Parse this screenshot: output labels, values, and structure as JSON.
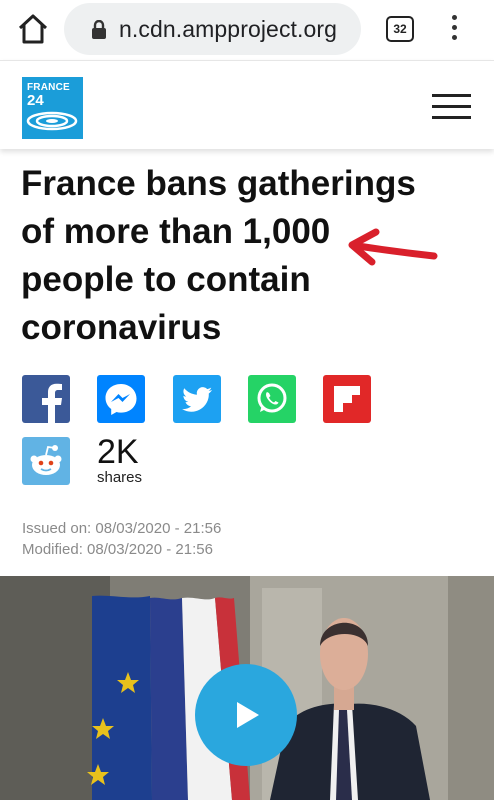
{
  "browser": {
    "url": "n.cdn.ampproject.org",
    "tab_count": "32",
    "icons": [
      "home-icon",
      "lock-icon",
      "kebab-menu-icon"
    ]
  },
  "site": {
    "logo_line1": "FRANCE",
    "logo_line2": "24",
    "colors": {
      "brand": "#1b9dd9"
    }
  },
  "article": {
    "headline": "France bans gatherings of more than 1,000 people to contain coronavirus",
    "issued": "Issued on: 08/03/2020 - 21:56",
    "modified": "Modified: 08/03/2020 - 21:56"
  },
  "share": {
    "networks": [
      "facebook",
      "messenger",
      "twitter",
      "whatsapp",
      "flipboard",
      "reddit"
    ],
    "count": "2K",
    "label": "shares",
    "colors": {
      "facebook": "#3b5998",
      "messenger": "#0084ff",
      "twitter": "#1da1f2",
      "whatsapp": "#25d366",
      "flipboard": "#e12828",
      "reddit": "#61b3e4"
    }
  },
  "video": {
    "play_color": "#2aa7de"
  }
}
